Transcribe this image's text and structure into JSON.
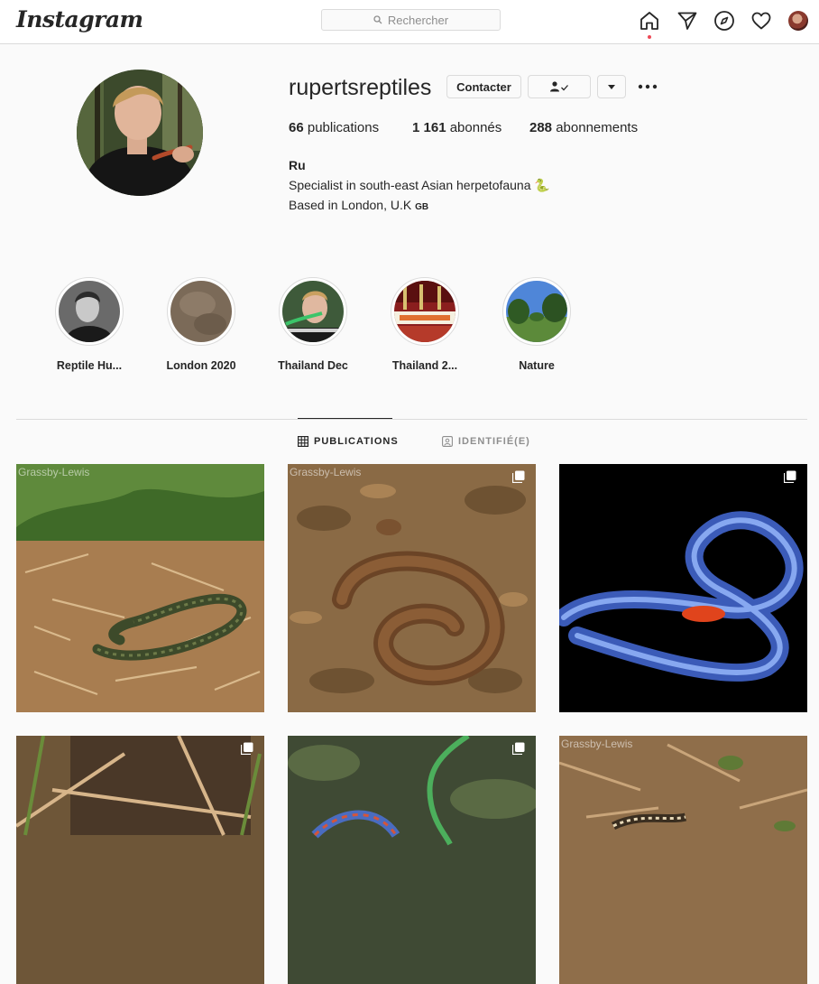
{
  "topbar": {
    "logo": "Instagram",
    "search_placeholder": "Rechercher",
    "icons": [
      "home-icon",
      "direct-icon",
      "explore-icon",
      "activity-icon",
      "profile-avatar"
    ]
  },
  "profile": {
    "username": "rupertsreptiles",
    "contact_label": "Contacter",
    "stats": [
      {
        "value": "66",
        "label": " publications"
      },
      {
        "value": "1 161",
        "label": " abonnés"
      },
      {
        "value": "288",
        "label": " abonnements"
      }
    ],
    "bio": {
      "name": "Ru",
      "line1": "Specialist in south-east Asian herpetofauna 🐍",
      "line2": "Based in London, U.K ",
      "flag": "GB"
    }
  },
  "highlights": [
    {
      "label": "Reptile Hu..."
    },
    {
      "label": "London 2020"
    },
    {
      "label": "Thailand Dec"
    },
    {
      "label": "Thailand 2..."
    },
    {
      "label": "Nature"
    }
  ],
  "tabs": [
    {
      "label": "PUBLICATIONS",
      "active": true
    },
    {
      "label": "IDENTIFIÉ(E)",
      "active": false
    }
  ],
  "posts": [
    {
      "watermark": "Grassby-Lewis",
      "subject": "grass snake on straw",
      "multi": false
    },
    {
      "watermark": "Grassby-Lewis",
      "subject": "brown coiled snake on leaves",
      "multi": true
    },
    {
      "watermark": "",
      "subject": "blue coral snake on black",
      "multi": true
    },
    {
      "watermark": "",
      "subject": "burrow in dirt",
      "multi": true
    },
    {
      "watermark": "",
      "subject": "green vine snake",
      "multi": true
    },
    {
      "watermark": "Grassby-Lewis",
      "subject": "patterned snake in leaf litter",
      "multi": false
    }
  ],
  "colors": {
    "accent": "#ed4956",
    "border": "#dbdbdb",
    "text": "#262626",
    "muted": "#8e8e8e"
  }
}
